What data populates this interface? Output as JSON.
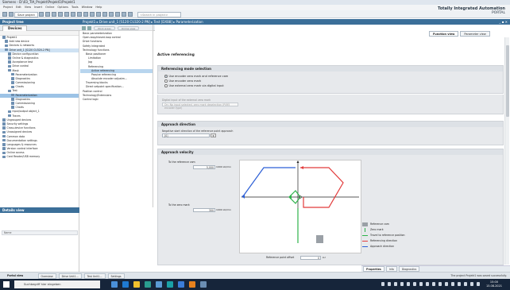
{
  "window": {
    "title": "Siemens - D:\\03_TIA_Projekt\\Projekt1\\Projekt1"
  },
  "menu": [
    "Project",
    "Edit",
    "View",
    "Insert",
    "Online",
    "Options",
    "Tools",
    "Window",
    "Help"
  ],
  "toolbar": {
    "save_label": "Save project",
    "search_placeholder": "<Search in project>"
  },
  "brand": {
    "line1": "Totally Integrated Automation",
    "line2": "PORTAL"
  },
  "project_tree": {
    "header": "Project tree",
    "devices_tab": "Devices",
    "items": [
      {
        "label": "Projekt1",
        "state": "normal"
      },
      {
        "label": "Add new device",
        "state": "normal"
      },
      {
        "label": "Devices & networks",
        "state": "normal"
      },
      {
        "label": "Drive unit_1 [S120 CU320-2 PN]",
        "state": "hl"
      },
      {
        "label": "Device configuration",
        "state": "normal"
      },
      {
        "label": "Online & diagnostics",
        "state": "normal"
      },
      {
        "label": "Acceptance test",
        "state": "normal"
      },
      {
        "label": "Drive control",
        "state": "normal"
      },
      {
        "label": "Mask",
        "state": "normal"
      },
      {
        "label": "Parameterization",
        "state": "normal"
      },
      {
        "label": "Diagnostics",
        "state": "normal"
      },
      {
        "label": "Commissioning",
        "state": "normal"
      },
      {
        "label": "Charts",
        "state": "normal"
      },
      {
        "label": "Test",
        "state": "normal"
      },
      {
        "label": "Parameterization",
        "state": "sel"
      },
      {
        "label": "Diagnostics",
        "state": "normal"
      },
      {
        "label": "Commissioning",
        "state": "normal"
      },
      {
        "label": "Charts",
        "state": "normal"
      },
      {
        "label": "Input/output object_1",
        "state": "normal"
      },
      {
        "label": "Traces",
        "state": "normal"
      },
      {
        "label": "Ungrouped devices",
        "state": "normal"
      },
      {
        "label": "Security settings",
        "state": "normal"
      },
      {
        "label": "Cross-device functions",
        "state": "normal"
      },
      {
        "label": "Unassigned devices",
        "state": "normal"
      },
      {
        "label": "Common data",
        "state": "normal"
      },
      {
        "label": "Documentation settings",
        "state": "normal"
      },
      {
        "label": "Languages & resources",
        "state": "normal"
      },
      {
        "label": "Version control interface",
        "state": "normal"
      },
      {
        "label": "Online access",
        "state": "normal"
      },
      {
        "label": "Card Reader/USB memory",
        "state": "normal"
      }
    ]
  },
  "details": {
    "header": "Details view",
    "col_name": "Name"
  },
  "breadcrumb": {
    "text": "Projekt1 ▸ Drive unit_1 [S120 CU320-2 PN] ▸ Test [DXB8] ▸ Parameterization",
    "controls": "_ ▪ ✕"
  },
  "nav_toolbar": {
    "pill1": "Work areas",
    "pill2": "Online view"
  },
  "param_nav": [
    {
      "label": "Basic parameterization",
      "state": "normal"
    },
    {
      "label": "Open-loop/closed-loop control",
      "state": "normal"
    },
    {
      "label": "Drive functions",
      "state": "normal"
    },
    {
      "label": "Safety Integrated",
      "state": "normal"
    },
    {
      "label": "Technology functions",
      "state": "normal"
    },
    {
      "label": "Basic positioner",
      "state": "normal"
    },
    {
      "label": "Limitation",
      "state": "normal"
    },
    {
      "label": "Jog",
      "state": "normal"
    },
    {
      "label": "Referencing",
      "state": "normal"
    },
    {
      "label": "Active referencing",
      "state": "sel"
    },
    {
      "label": "Passive referencing",
      "state": "normal"
    },
    {
      "label": "Absolute encoder adjustm...",
      "state": "normal"
    },
    {
      "label": "Traversing blocks",
      "state": "normal"
    },
    {
      "label": "Direct setpoint specification...",
      "state": "normal"
    },
    {
      "label": "Position control",
      "state": "normal"
    },
    {
      "label": "Technology/Extensions",
      "state": "normal"
    },
    {
      "label": "Control logic",
      "state": "normal"
    }
  ],
  "view_tabs": {
    "function": "Function view",
    "parameter": "Parameter view"
  },
  "section": {
    "title": "Active referencing"
  },
  "ref_mode": {
    "header": "Referencing mode selection",
    "options": [
      "Use encoder zero mark and reference cam",
      "Use encoder zero mark",
      "Use external zero mark via digital input"
    ],
    "selected": 0,
    "input_label": "Digital input of the external zero mark",
    "input_value": "On: No input selected, zero mark deselection (P495 encoder type)"
  },
  "approach_dir": {
    "header": "Approach direction",
    "label": "Negative start direction of the reference point approach",
    "value": "[0]"
  },
  "approach_vel": {
    "header": "Approach velocity",
    "to_cam_label": "To the reference cam",
    "to_cam_value": "5,000",
    "to_cam_unit": "1000 LU/min",
    "to_zero_label": "To the zero mark",
    "to_zero_value": "300",
    "to_zero_unit": "1000 LU/min",
    "offset_label": "Reference point offset",
    "offset_value": "0",
    "offset_unit": "LU"
  },
  "legend": [
    {
      "label": "Reference cam",
      "color": "#9aa0a6"
    },
    {
      "label": "Zero mark",
      "color": "#2db24a"
    },
    {
      "label": "Travel to reference position",
      "color": "#2db24a"
    },
    {
      "label": "Referencing direction",
      "color": "#e23b3b"
    },
    {
      "label": "Approach direction",
      "color": "#2c5fd6"
    }
  ],
  "bottom_tabs": {
    "properties": "Properties",
    "info": "Info",
    "diagnostics": "Diagnostics"
  },
  "portal_bar": {
    "portal_view": "Portal view",
    "tabs": [
      "Overview",
      "Drive Unit1...",
      "Test Unit1...",
      "Settings"
    ],
    "status": "The project Projekt1 was saved successfully."
  },
  "taskbar": {
    "search": "Suchbegriff hier eingeben",
    "time": "15:00",
    "date": "13.08.2021"
  }
}
